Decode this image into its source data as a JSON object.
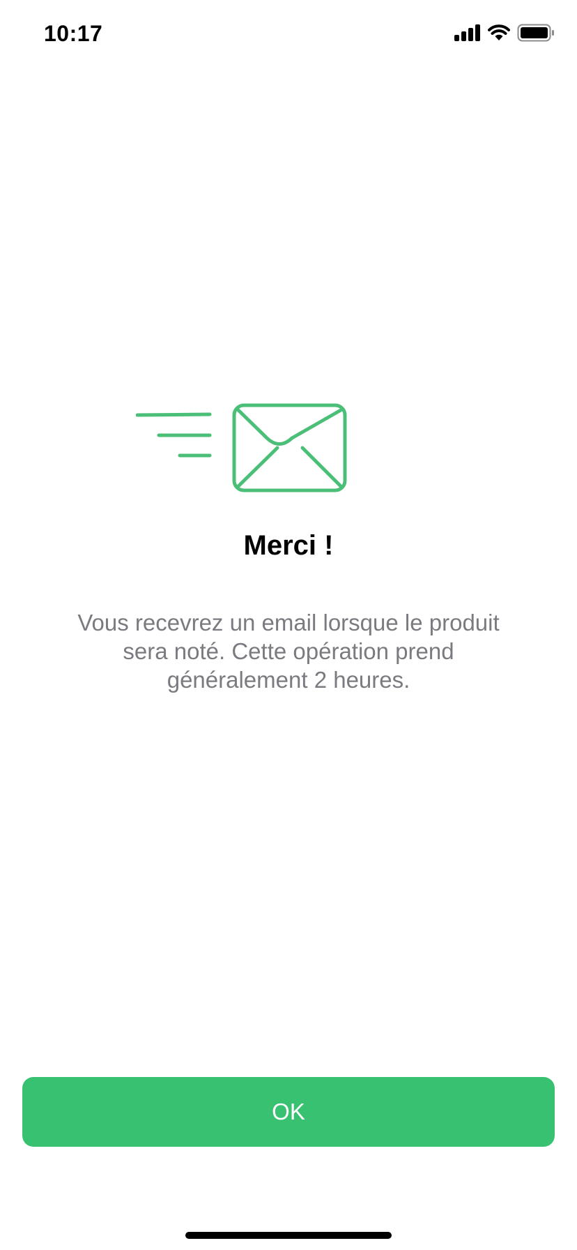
{
  "status_bar": {
    "time": "10:17",
    "icons": [
      "signal-icon",
      "wifi-icon",
      "battery-icon"
    ]
  },
  "illustration": {
    "icon": "envelope-sent-icon",
    "color": "#4bbf78"
  },
  "content": {
    "title": "Merci !",
    "message": "Vous recevrez un email lorsque le produit sera noté. Cette opération prend généralement 2 heures."
  },
  "actions": {
    "ok_label": "OK",
    "button_color": "#39c172"
  }
}
